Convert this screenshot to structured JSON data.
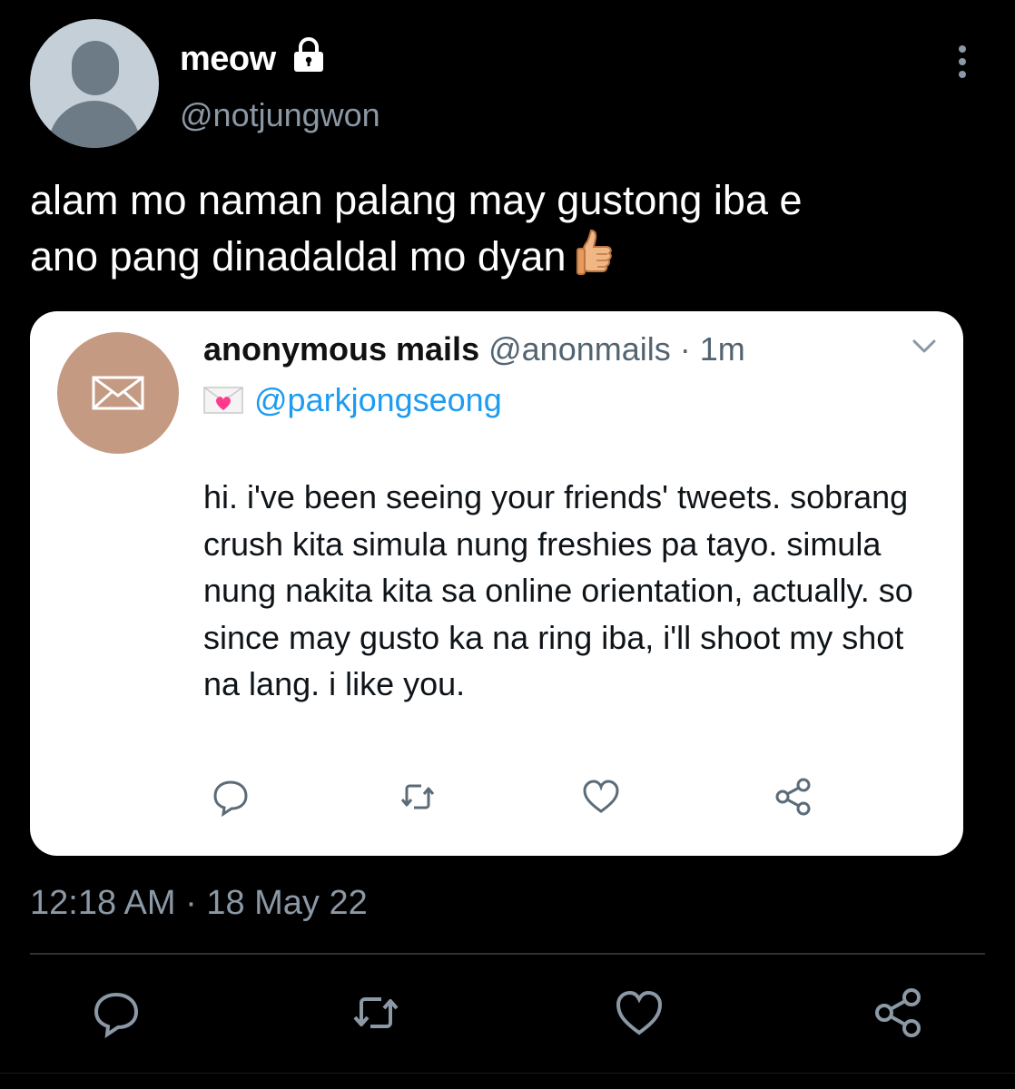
{
  "tweet": {
    "display_name": "meow",
    "handle": "@notjungwon",
    "text_line1": "alam mo naman palang may gustong iba e",
    "text_line2": "ano pang dinadaldal mo dyan",
    "emoji": "thumbs-up",
    "timestamp": "12:18 AM · 18 May 22",
    "protected": true
  },
  "quoted": {
    "name": "anonymous mails",
    "handle": "@anonmails",
    "separator": "·",
    "time": "1m",
    "recipient_icon": "love-letter-icon",
    "recipient": "@parkjongseong",
    "body": "hi. i've been seeing your friends' tweets. sobrang crush kita simula nung freshies pa tayo. simula nung nakita kita sa online orientation, actually. so since may gusto ka na ring iba, i'll shoot my shot na lang. i like you."
  },
  "icons": {
    "actions": [
      "reply-icon",
      "retweet-icon",
      "like-icon",
      "share-icon"
    ]
  },
  "colors": {
    "background": "#000000",
    "secondary_text": "#8b98a5",
    "link": "#1d9bf0",
    "avatar_quoted": "#c49a82"
  }
}
